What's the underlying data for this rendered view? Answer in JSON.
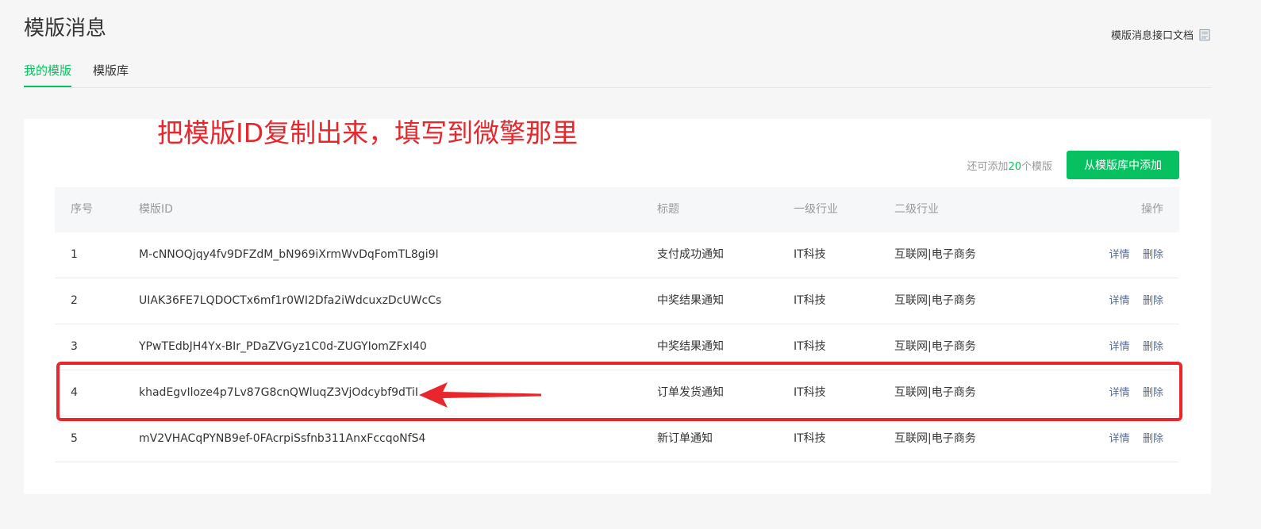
{
  "header": {
    "title": "模版消息",
    "doc_link": "模版消息接口文档",
    "doc_icon": "document-icon"
  },
  "tabs": [
    {
      "label": "我的模版",
      "active": true
    },
    {
      "label": "模版库",
      "active": false
    }
  ],
  "annotation": {
    "text": "把模版ID复制出来，填写到微擎那里",
    "color": "#e8262b"
  },
  "quota": {
    "prefix": "还可添加",
    "count": "20",
    "suffix": "个模版"
  },
  "add_button": "从模版库中添加",
  "table": {
    "headers": {
      "index": "序号",
      "template_id": "模版ID",
      "title": "标题",
      "industry1": "一级行业",
      "industry2": "二级行业",
      "ops": "操作"
    },
    "rows": [
      {
        "index": "1",
        "template_id": "M-cNNOQjqy4fv9DFZdM_bN969iXrmWvDqFomTL8gi9I",
        "title": "支付成功通知",
        "industry1": "IT科技",
        "industry2": "互联网|电子商务",
        "detail": "详情",
        "delete": "删除"
      },
      {
        "index": "2",
        "template_id": "UIAK36FE7LQDOCTx6mf1r0WI2Dfa2iWdcuxzDcUWcCs",
        "title": "中奖结果通知",
        "industry1": "IT科技",
        "industry2": "互联网|电子商务",
        "detail": "详情",
        "delete": "删除"
      },
      {
        "index": "3",
        "template_id": "YPwTEdbJH4Yx-BIr_PDaZVGyz1C0d-ZUGYIomZFxI40",
        "title": "中奖结果通知",
        "industry1": "IT科技",
        "industry2": "互联网|电子商务",
        "detail": "详情",
        "delete": "删除"
      },
      {
        "index": "4",
        "template_id": "khadEgvIloze4p7Lv87G8cnQWluqZ3VjOdcybf9dTiI",
        "title": "订单发货通知",
        "industry1": "IT科技",
        "industry2": "互联网|电子商务",
        "detail": "详情",
        "delete": "删除",
        "highlighted": true
      },
      {
        "index": "5",
        "template_id": "mV2VHACqPYNB9ef-0FAcrpiSsfnb311AnxFccqoNfS4",
        "title": "新订单通知",
        "industry1": "IT科技",
        "industry2": "互联网|电子商务",
        "detail": "详情",
        "delete": "删除"
      }
    ]
  },
  "colors": {
    "accent": "#07c160",
    "link": "#576b95",
    "annotation": "#e8262b"
  }
}
